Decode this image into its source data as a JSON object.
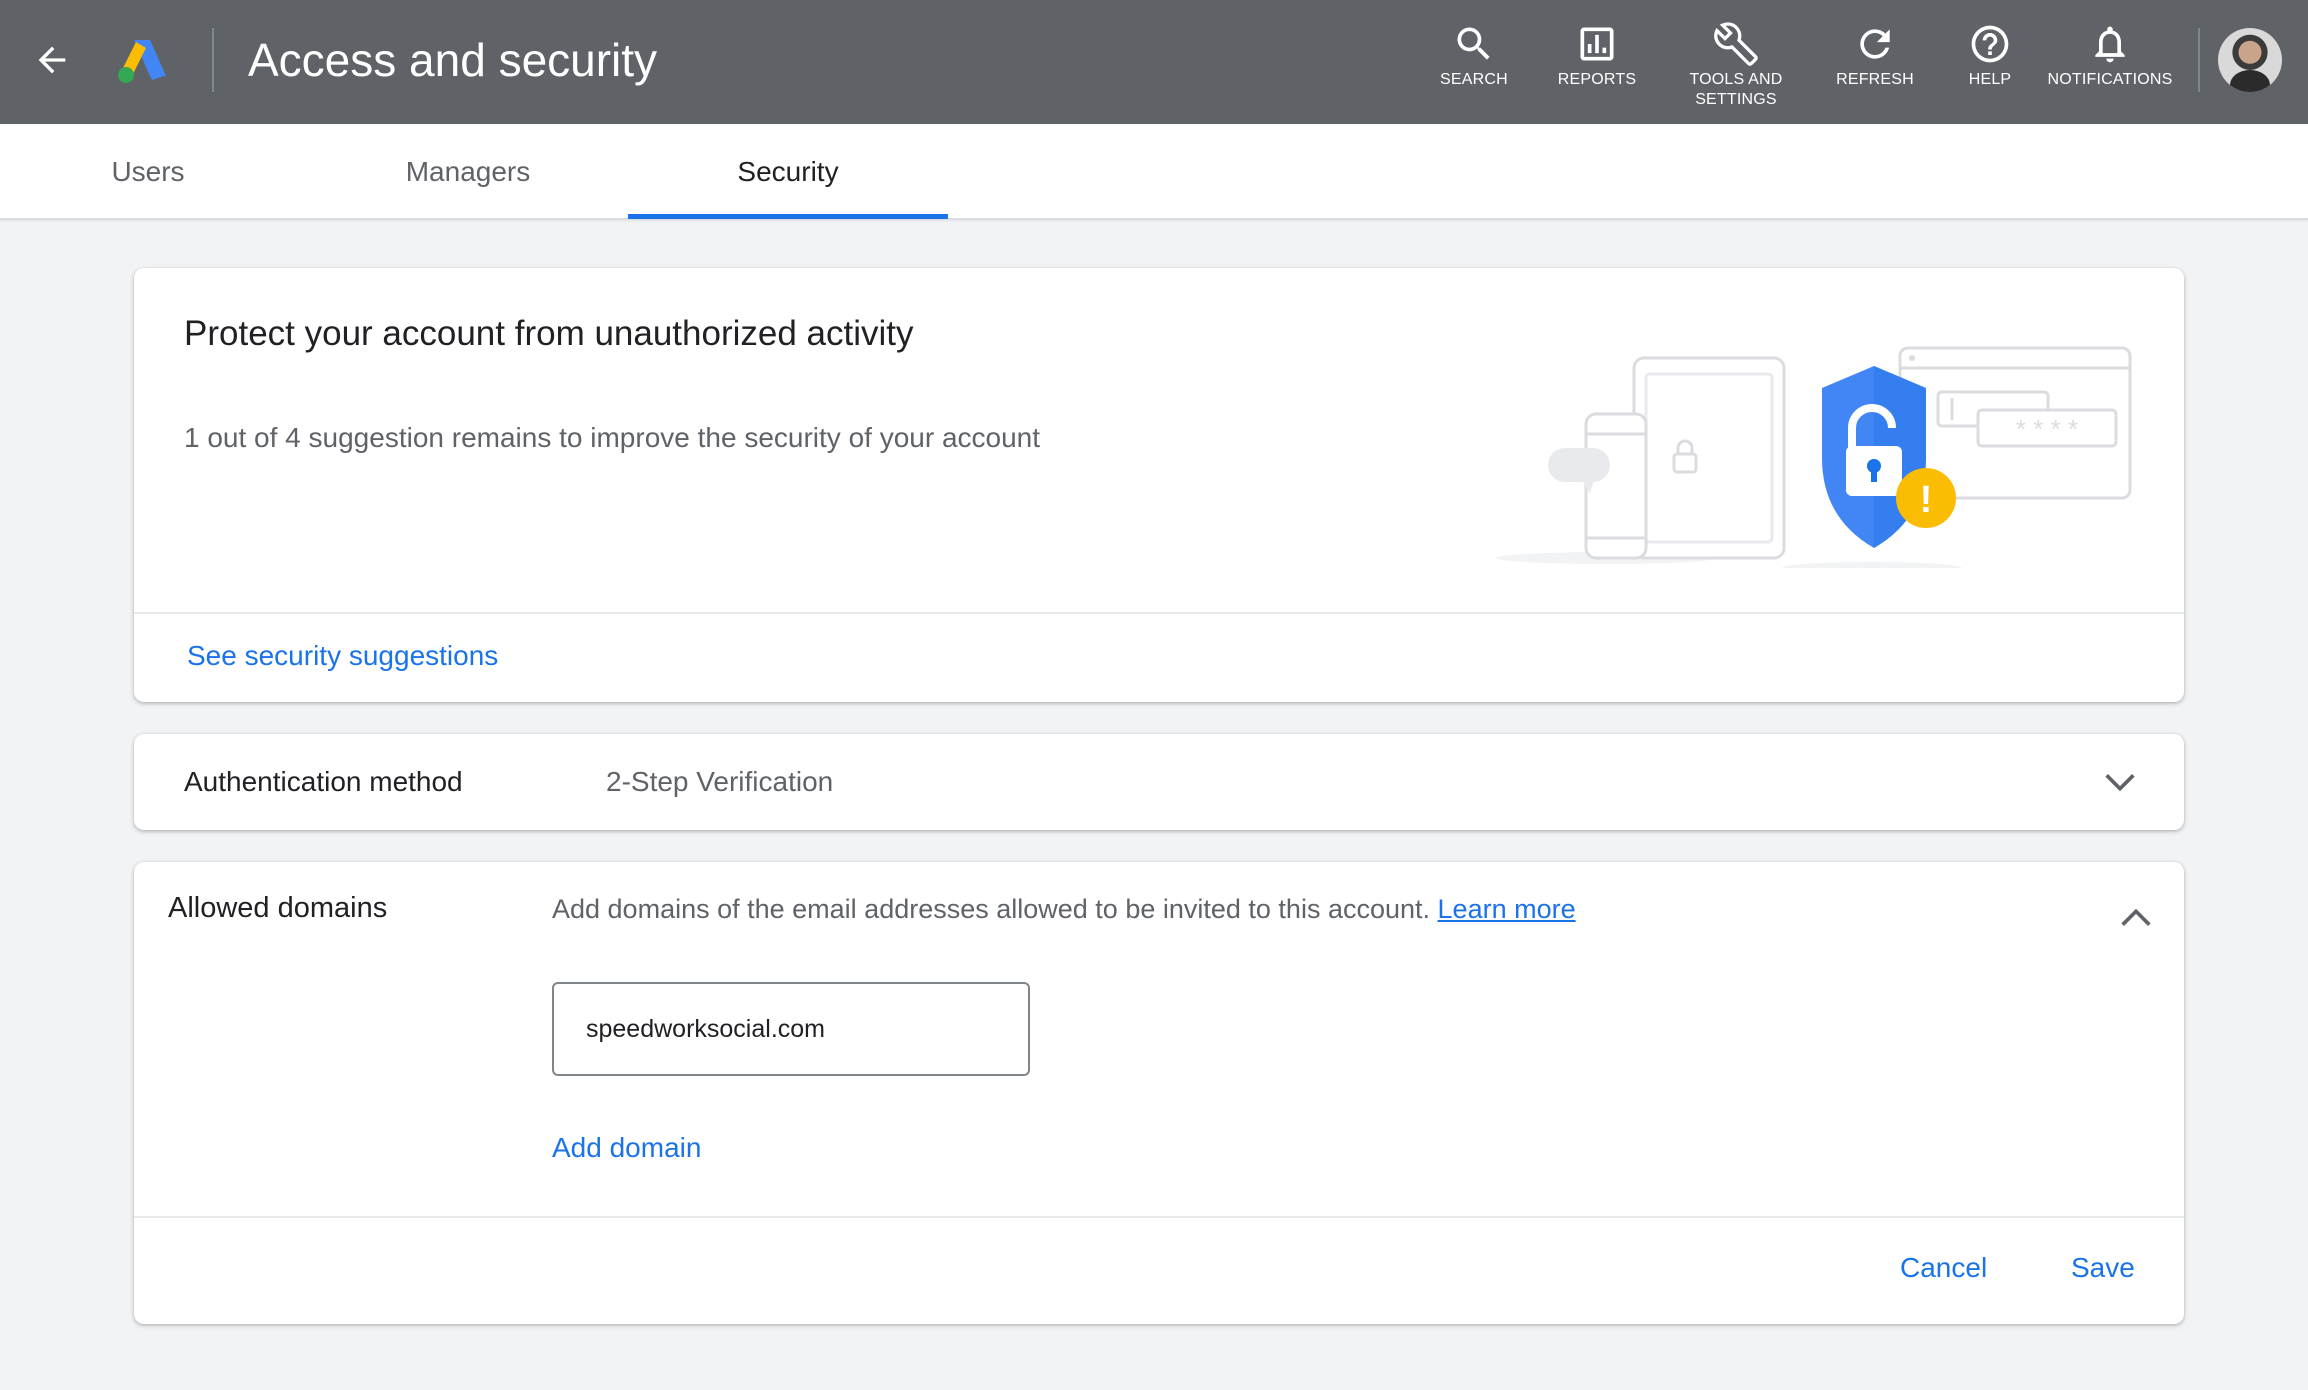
{
  "header": {
    "title": "Access and security",
    "back_icon": "arrow-back-icon",
    "logo_icon": "google-ads-logo",
    "tools": [
      {
        "label": "SEARCH",
        "icon": "search-icon"
      },
      {
        "label": "REPORTS",
        "icon": "bar-chart-icon"
      },
      {
        "label": "TOOLS AND SETTINGS",
        "icon": "wrench-icon"
      },
      {
        "label": "REFRESH",
        "icon": "refresh-icon"
      },
      {
        "label": "HELP",
        "icon": "help-icon"
      },
      {
        "label": "NOTIFICATIONS",
        "icon": "bell-icon"
      }
    ],
    "background": "#5f6368"
  },
  "tabs": {
    "items": [
      {
        "label": "Users"
      },
      {
        "label": "Managers"
      },
      {
        "label": "Security"
      }
    ],
    "active": "Security",
    "accent": "#1a73e8"
  },
  "protect_card": {
    "title": "Protect your account from unauthorized activity",
    "subtitle": "1 out of 4 suggestion remains to improve the security of your account",
    "link": "See security suggestions",
    "illustration_icon": "shield-lock-warning-illustration",
    "illustration_password": "* * * *",
    "warning_mark": "!"
  },
  "auth_card": {
    "label": "Authentication method",
    "value": "2-Step Verification",
    "expand_icon": "chevron-down-icon"
  },
  "domains_card": {
    "label": "Allowed domains",
    "description": "Add domains of the email addresses allowed to be invited to this account.",
    "learn_more": "Learn more",
    "collapse_icon": "chevron-up-icon",
    "domain_value": "speedworksocial.com",
    "add_domain": "Add domain",
    "cancel": "Cancel",
    "save": "Save"
  }
}
